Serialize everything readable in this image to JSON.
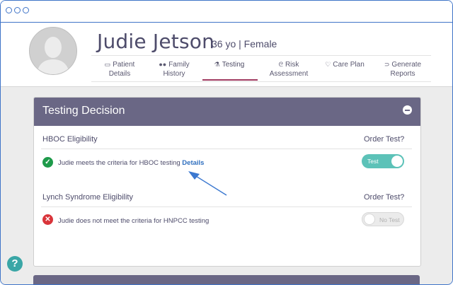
{
  "patient": {
    "name": "Judie Jetson",
    "meta": "36 yo | Female"
  },
  "nav": {
    "items": [
      {
        "line1": "Patient",
        "line2": "Details",
        "icon": "document-icon"
      },
      {
        "line1": "Family",
        "line2": "History",
        "icon": "users-icon"
      },
      {
        "line1": "Testing",
        "line2": "",
        "icon": "flask-icon"
      },
      {
        "line1": "Risk",
        "line2": "Assessment",
        "icon": "stethoscope-icon"
      },
      {
        "line1": "Care Plan",
        "line2": "",
        "icon": "heart-icon"
      },
      {
        "line1": "Generate",
        "line2": "Reports",
        "icon": "folder-icon"
      }
    ],
    "active": "Testing"
  },
  "panel": {
    "title": "Testing Decision",
    "hboc": {
      "title": "HBOC Eligibility",
      "order_label": "Order Test?",
      "message": "Judie meets the criteria for HBOC testing",
      "link": "Details",
      "toggle_label": "Test",
      "status_color": "#1e9a4a",
      "toggle_color": "#5cc2b8"
    },
    "lynch": {
      "title": "Lynch Syndrome Eligibility",
      "order_label": "Order Test?",
      "message": "Judie does not meet the criteria for HNPCC testing",
      "toggle_label": "No Test",
      "status_color": "#d9343a"
    }
  },
  "help": {
    "label": "?"
  }
}
